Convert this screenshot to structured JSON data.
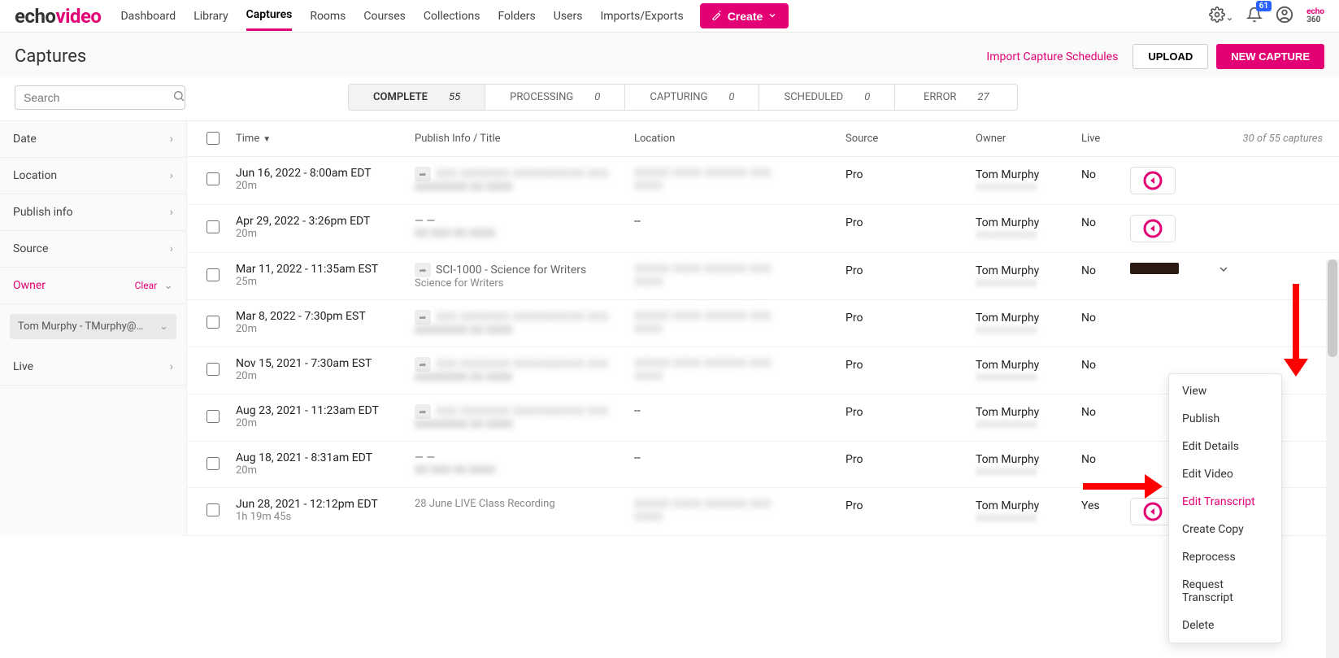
{
  "brand": {
    "part1": "echo",
    "part2": "video"
  },
  "nav": {
    "items": [
      {
        "label": "Dashboard",
        "active": false
      },
      {
        "label": "Library",
        "active": false
      },
      {
        "label": "Captures",
        "active": true
      },
      {
        "label": "Rooms",
        "active": false
      },
      {
        "label": "Courses",
        "active": false
      },
      {
        "label": "Collections",
        "active": false
      },
      {
        "label": "Folders",
        "active": false
      },
      {
        "label": "Users",
        "active": false
      },
      {
        "label": "Imports/Exports",
        "active": false
      }
    ],
    "create_label": "Create"
  },
  "notifications": {
    "count": "61"
  },
  "footer_brand": {
    "part1": "echo",
    "part2": "360"
  },
  "page": {
    "title": "Captures",
    "import_link": "Import Capture Schedules",
    "upload_btn": "UPLOAD",
    "new_btn": "NEW CAPTURE"
  },
  "search": {
    "placeholder": "Search"
  },
  "status_tabs": [
    {
      "label": "COMPLETE",
      "count": "55",
      "active": true
    },
    {
      "label": "PROCESSING",
      "count": "0",
      "active": false
    },
    {
      "label": "CAPTURING",
      "count": "0",
      "active": false
    },
    {
      "label": "SCHEDULED",
      "count": "0",
      "active": false
    },
    {
      "label": "ERROR",
      "count": "27",
      "active": false
    }
  ],
  "filters": {
    "date": "Date",
    "location": "Location",
    "publish": "Publish info",
    "source": "Source",
    "owner": "Owner",
    "clear": "Clear",
    "owner_chip": "Tom Murphy - TMurphy@…",
    "live": "Live"
  },
  "table": {
    "headers": {
      "time": "Time",
      "publish": "Publish Info / Title",
      "location": "Location",
      "source": "Source",
      "owner": "Owner",
      "live": "Live"
    },
    "count_label": "30 of 55 captures",
    "rows": [
      {
        "time": "Jun 16, 2022 - 8:00am EDT",
        "dur": "20m",
        "pub_line1_blurred": true,
        "pub_line1": "",
        "pub_line2": "",
        "loc_blurred": true,
        "loc": "",
        "source": "Pro",
        "owner": "Tom Murphy",
        "live": "No",
        "action": "rec"
      },
      {
        "time": "Apr 29, 2022 - 3:26pm EDT",
        "dur": "20m",
        "pub_line1_blurred": false,
        "pub_line1": "— —",
        "pub_line2": "",
        "loc_blurred": false,
        "loc": "--",
        "source": "Pro",
        "owner": "Tom Murphy",
        "live": "No",
        "action": "rec"
      },
      {
        "time": "Mar 11, 2022 - 11:35am EST",
        "dur": "25m",
        "pub_line1_blurred": false,
        "pub_line1": "SCI-1000 - Science for Writers",
        "pub_line2": "Science for Writers",
        "loc_blurred": true,
        "loc": "",
        "source": "Pro",
        "owner": "Tom Murphy",
        "live": "No",
        "action": "thumb"
      },
      {
        "time": "Mar 8, 2022 - 7:30pm EST",
        "dur": "20m",
        "pub_line1_blurred": true,
        "pub_line1": "",
        "pub_line2": "",
        "loc_blurred": true,
        "loc": "",
        "source": "Pro",
        "owner": "Tom Murphy",
        "live": "No",
        "action": "none"
      },
      {
        "time": "Nov 15, 2021 - 7:30am EST",
        "dur": "20m",
        "pub_line1_blurred": true,
        "pub_line1": "",
        "pub_line2": "",
        "loc_blurred": true,
        "loc": "",
        "source": "Pro",
        "owner": "Tom Murphy",
        "live": "No",
        "action": "none"
      },
      {
        "time": "Aug 23, 2021 - 11:23am EDT",
        "dur": "20m",
        "pub_line1_blurred": true,
        "pub_line1": "",
        "pub_line2": "",
        "loc_blurred": false,
        "loc": "--",
        "source": "Pro",
        "owner": "Tom Murphy",
        "live": "No",
        "action": "none"
      },
      {
        "time": "Aug 18, 2021 - 8:31am EDT",
        "dur": "20m",
        "pub_line1_blurred": false,
        "pub_line1": "— —",
        "pub_line2": "",
        "loc_blurred": false,
        "loc": "--",
        "source": "Pro",
        "owner": "Tom Murphy",
        "live": "No",
        "action": "none"
      },
      {
        "time": "Jun 28, 2021 - 12:12pm EDT",
        "dur": "1h 19m 45s",
        "pub_line1_blurred": false,
        "pub_line1": "",
        "pub_line2": "28 June LIVE Class Recording",
        "loc_blurred": true,
        "loc": "",
        "source": "Pro",
        "owner": "Tom Murphy",
        "live": "Yes",
        "action": "rec"
      }
    ]
  },
  "context_menu": {
    "items": [
      {
        "label": "View",
        "highlight": false
      },
      {
        "label": "Publish",
        "highlight": false
      },
      {
        "label": "Edit Details",
        "highlight": false
      },
      {
        "label": "Edit Video",
        "highlight": false
      },
      {
        "label": "Edit Transcript",
        "highlight": true
      },
      {
        "label": "Create Copy",
        "highlight": false
      },
      {
        "label": "Reprocess",
        "highlight": false
      },
      {
        "label": "Request Transcript",
        "highlight": false
      },
      {
        "label": "Delete",
        "highlight": false
      }
    ]
  }
}
